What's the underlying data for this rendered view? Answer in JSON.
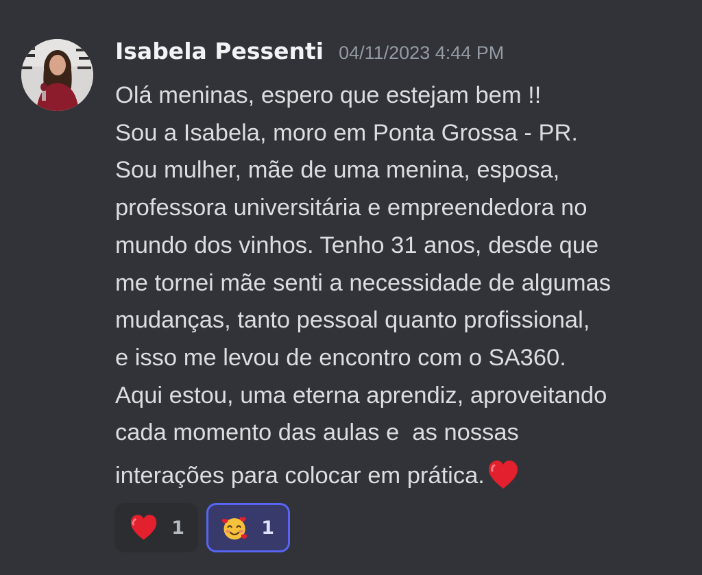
{
  "message": {
    "author": "Isabela Pessenti",
    "timestamp": "04/11/2023 4:44 PM",
    "lines": [
      "Olá meninas, espero que estejam bem !!",
      "Sou a Isabela, moro em Ponta Grossa - PR.",
      "Sou mulher, mãe de uma menina, esposa,",
      "professora universitária e empreendedora no",
      "mundo dos vinhos. Tenho 31 anos, desde que",
      "me tornei mãe senti a necessidade de algumas",
      "mudanças, tanto pessoal quanto profissional,",
      "e isso me levou de encontro com o SA360.",
      "Aqui estou, uma eterna aprendiz, aproveitando",
      "cada momento das aulas e  as nossas",
      "interações para colocar em prática."
    ],
    "trailing_emoji": "red-heart"
  },
  "reactions": [
    {
      "emoji": "red-heart",
      "count": "1",
      "selected": false
    },
    {
      "emoji": "smiling-face-with-hearts",
      "count": "1",
      "selected": true
    }
  ],
  "colors": {
    "background": "#313338",
    "username": "#f2f3f5",
    "timestamp": "#949ba4",
    "text": "#dbdee1",
    "reaction_bg": "#2b2d31",
    "reaction_selected_bg": "#373a6b",
    "reaction_selected_border": "#5865f2",
    "heart": "#e3202e"
  }
}
